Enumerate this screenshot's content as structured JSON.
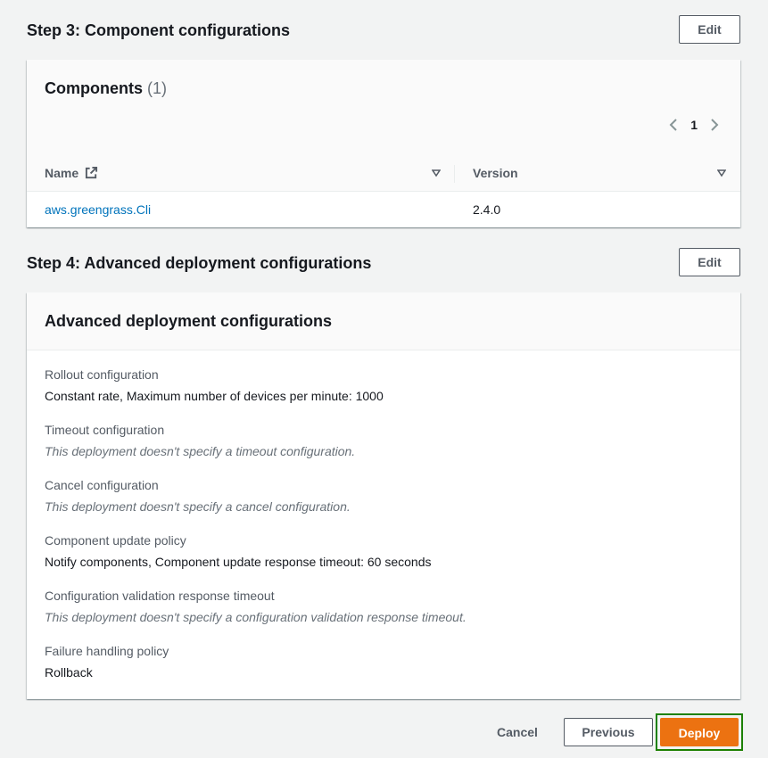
{
  "step3": {
    "title": "Step 3: Component configurations",
    "edit_label": "Edit",
    "panel_title": "Components",
    "count": "(1)",
    "pagination": {
      "current_page": "1"
    },
    "table": {
      "columns": [
        "Name",
        "Version"
      ],
      "rows": [
        {
          "name": "aws.greengrass.Cli",
          "version": "2.4.0"
        }
      ]
    }
  },
  "step4": {
    "title": "Step 4: Advanced deployment configurations",
    "edit_label": "Edit",
    "panel_title": "Advanced deployment configurations",
    "fields": [
      {
        "label": "Rollout configuration",
        "value": "Constant rate, Maximum number of devices per minute: 1000"
      },
      {
        "label": "Timeout configuration",
        "value": "This deployment doesn't specify a timeout configuration."
      },
      {
        "label": "Cancel configuration",
        "value": "This deployment doesn't specify a cancel configuration."
      },
      {
        "label": "Component update policy",
        "value": "Notify components, Component update response timeout: 60 seconds"
      },
      {
        "label": "Configuration validation response timeout",
        "value": "This deployment doesn't specify a configuration validation response timeout."
      },
      {
        "label": "Failure handling policy",
        "value": "Rollback"
      }
    ]
  },
  "footer": {
    "cancel_label": "Cancel",
    "previous_label": "Previous",
    "deploy_label": "Deploy"
  },
  "colors": {
    "link": "#0073bb",
    "primary_button": "#ec7211",
    "focus_ring": "#1d8102"
  }
}
